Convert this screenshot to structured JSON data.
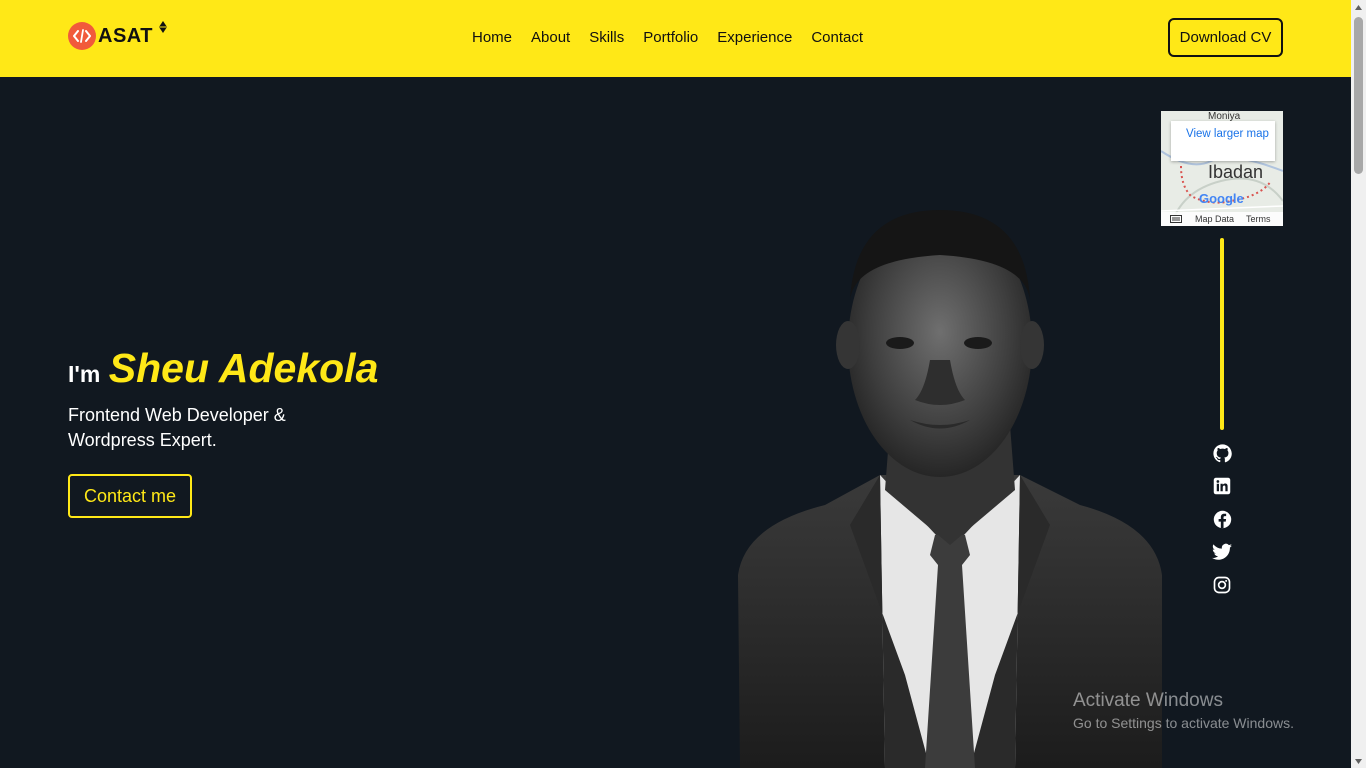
{
  "brand": {
    "name": "ASAT",
    "accent": "#ffe817",
    "badge_color": "#f15a3b",
    "background": "#111820"
  },
  "nav": {
    "items": [
      {
        "label": "Home"
      },
      {
        "label": "About"
      },
      {
        "label": "Skills"
      },
      {
        "label": "Portfolio"
      },
      {
        "label": "Experience"
      },
      {
        "label": "Contact"
      }
    ],
    "cv_label": "Download CV"
  },
  "hero": {
    "greeting": "I'm",
    "name": "Sheu Adekola",
    "role_line1": "Frontend Web Developer &",
    "role_line2": "Wordpress Expert.",
    "cta_label": "Contact me"
  },
  "map": {
    "link_label": "View larger map",
    "top_label": "Moniya",
    "city": "Ibadan",
    "logo": "Google",
    "data_label": "Map Data",
    "terms_label": "Terms"
  },
  "social": [
    "github-icon",
    "linkedin-icon",
    "facebook-icon",
    "twitter-icon",
    "instagram-icon"
  ],
  "watermark": {
    "title": "Activate Windows",
    "subtitle": "Go to Settings to activate Windows."
  }
}
